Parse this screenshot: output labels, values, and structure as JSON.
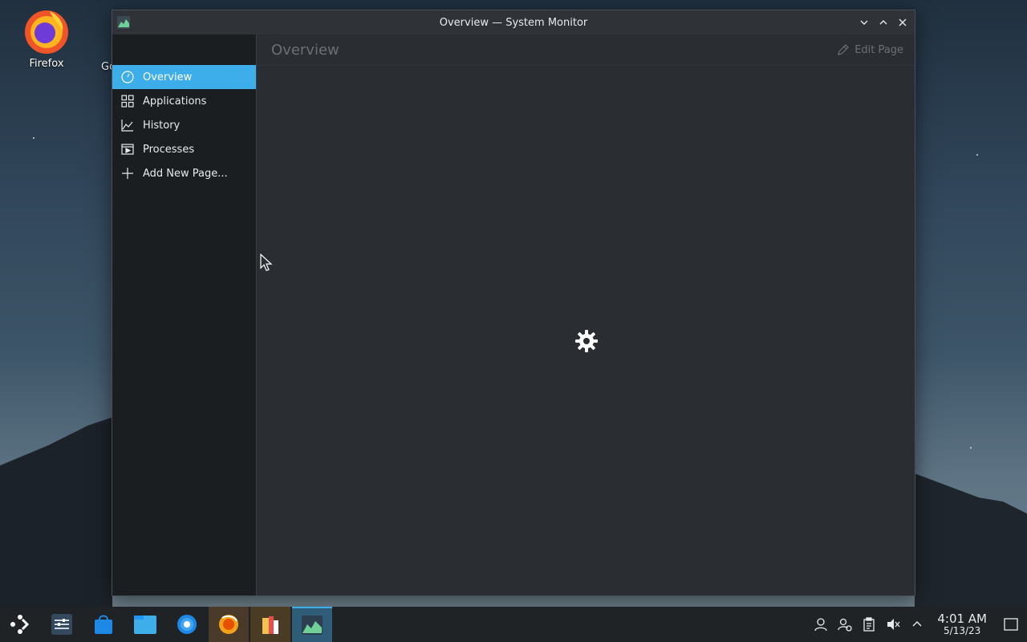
{
  "desktop": {
    "icons": [
      {
        "label": "Firefox",
        "icon": "firefox-icon"
      },
      {
        "label": "Go",
        "icon": "unknown-app-icon"
      }
    ]
  },
  "window": {
    "title": "Overview — System Monitor",
    "app_icon": "system-monitor-icon",
    "buttons": [
      "minimize",
      "maximize",
      "close"
    ]
  },
  "sidebar": {
    "items": [
      {
        "label": "Overview",
        "icon": "overview-icon",
        "active": true
      },
      {
        "label": "Applications",
        "icon": "applications-icon",
        "active": false
      },
      {
        "label": "History",
        "icon": "history-icon",
        "active": false
      },
      {
        "label": "Processes",
        "icon": "processes-icon",
        "active": false
      },
      {
        "label": "Add New Page...",
        "icon": "plus-icon",
        "active": false
      }
    ]
  },
  "main": {
    "page_title": "Overview",
    "edit_label": "Edit Page",
    "loading_icon": "gear-spinner-icon"
  },
  "taskbar": {
    "apps": [
      "app-launcher",
      "mixer",
      "discover-store",
      "file-manager",
      "system-settings",
      "firefox-like-app",
      "app-bundle",
      "system-monitor"
    ],
    "tray": [
      "user-icon",
      "user-switch-icon",
      "clipboard-icon",
      "volume-muted-icon",
      "expand-tray-icon"
    ],
    "clock": {
      "time": "4:01 AM",
      "date": "5/13/23"
    }
  },
  "colors": {
    "accent": "#3daee9",
    "sidebar_bg": "#1b1e20",
    "window_bg": "#2a2e32"
  }
}
